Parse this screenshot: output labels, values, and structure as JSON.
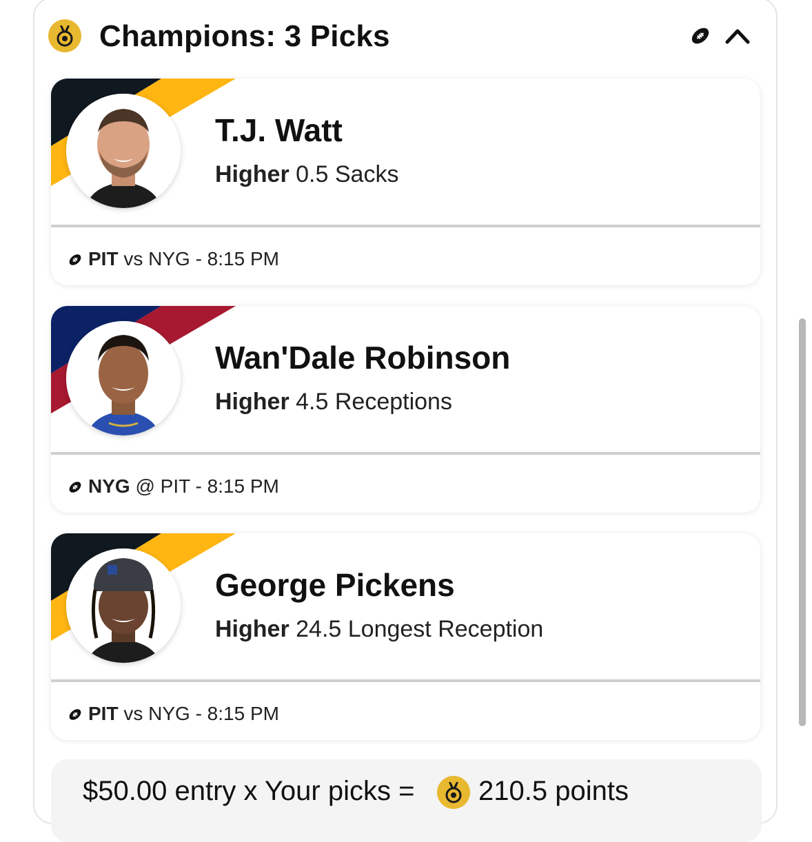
{
  "header": {
    "title": "Champions: 3 Picks",
    "medal_icon": "medal-icon",
    "sport_icon": "football-icon",
    "collapse_icon": "chevron-up-icon"
  },
  "picks": [
    {
      "player_name": "T.J. Watt",
      "direction": "Higher",
      "line": "0.5 Sacks",
      "team": "PIT",
      "matchup": "vs NYG - 8:15 PM",
      "stripe_colors": [
        "#101820",
        "#FFB612"
      ]
    },
    {
      "player_name": "Wan'Dale Robinson",
      "direction": "Higher",
      "line": "4.5 Receptions",
      "team": "NYG",
      "matchup": "@ PIT - 8:15 PM",
      "stripe_colors": [
        "#0B2265",
        "#A71930"
      ]
    },
    {
      "player_name": "George Pickens",
      "direction": "Higher",
      "line": "24.5 Longest Reception",
      "team": "PIT",
      "matchup": "vs NYG - 8:15 PM",
      "stripe_colors": [
        "#101820",
        "#FFB612"
      ]
    }
  ],
  "footer": {
    "entry_text": "$50.00 entry x Your picks =",
    "points": "210.5 points"
  },
  "colors": {
    "medal": "#E8B830",
    "divider": "#CFCFCF",
    "footer_bg": "#F4F4F4"
  }
}
